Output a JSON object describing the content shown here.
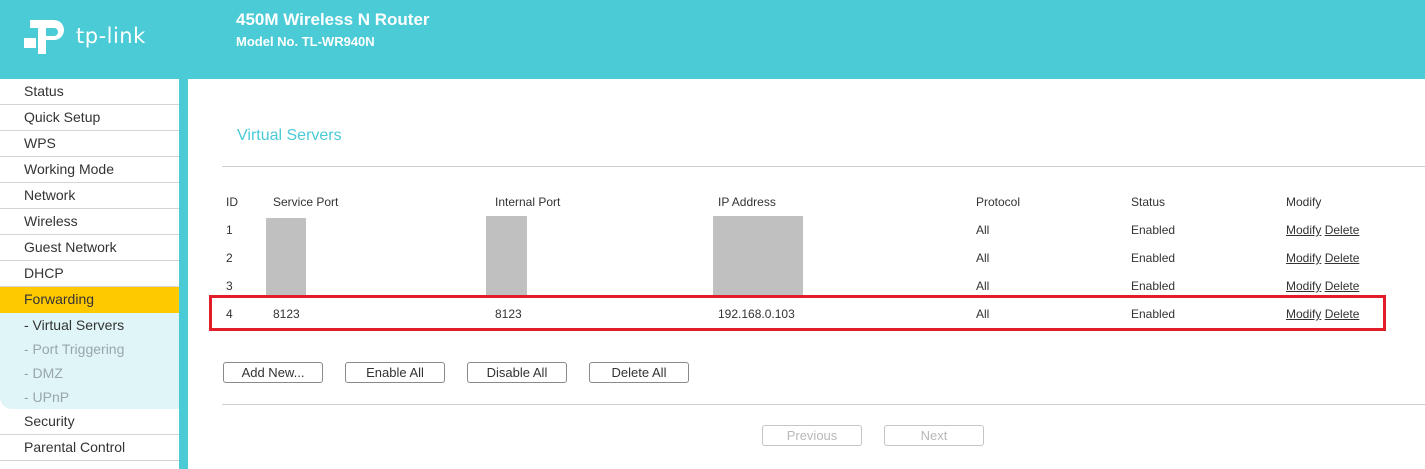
{
  "header": {
    "logo_text": "tp-link",
    "product_title": "450M Wireless N Router",
    "model": "Model No. TL-WR940N"
  },
  "colors": {
    "brand": "#4acbd6",
    "active_menu": "#ffc900",
    "highlight": "#e11d2a"
  },
  "sidebar": {
    "items": [
      {
        "label": "Status"
      },
      {
        "label": "Quick Setup"
      },
      {
        "label": "WPS"
      },
      {
        "label": "Working Mode"
      },
      {
        "label": "Network"
      },
      {
        "label": "Wireless"
      },
      {
        "label": "Guest Network"
      },
      {
        "label": "DHCP"
      },
      {
        "label": "Forwarding"
      },
      {
        "label": "Security"
      },
      {
        "label": "Parental Control"
      }
    ],
    "sub_items": [
      {
        "label": "- Virtual Servers"
      },
      {
        "label": "- Port Triggering"
      },
      {
        "label": "- DMZ"
      },
      {
        "label": "- UPnP"
      }
    ]
  },
  "main": {
    "title": "Virtual Servers",
    "columns": [
      "ID",
      "Service Port",
      "Internal Port",
      "IP Address",
      "Protocol",
      "Status",
      "Modify"
    ],
    "rows": [
      {
        "id": "1",
        "service_port": "",
        "internal_port": "",
        "ip": "",
        "protocol": "All",
        "status": "Enabled",
        "modify": "Modify",
        "delete": "Delete"
      },
      {
        "id": "2",
        "service_port": "",
        "internal_port": "",
        "ip": "",
        "protocol": "All",
        "status": "Enabled",
        "modify": "Modify",
        "delete": "Delete"
      },
      {
        "id": "3",
        "service_port": "",
        "internal_port": "",
        "ip": "",
        "protocol": "All",
        "status": "Enabled",
        "modify": "Modify",
        "delete": "Delete"
      },
      {
        "id": "4",
        "service_port": "8123",
        "internal_port": "8123",
        "ip": "192.168.0.103",
        "protocol": "All",
        "status": "Enabled",
        "modify": "Modify",
        "delete": "Delete"
      }
    ],
    "buttons": {
      "add_new": "Add New...",
      "enable_all": "Enable All",
      "disable_all": "Disable All",
      "delete_all": "Delete All",
      "previous": "Previous",
      "next": "Next"
    }
  }
}
